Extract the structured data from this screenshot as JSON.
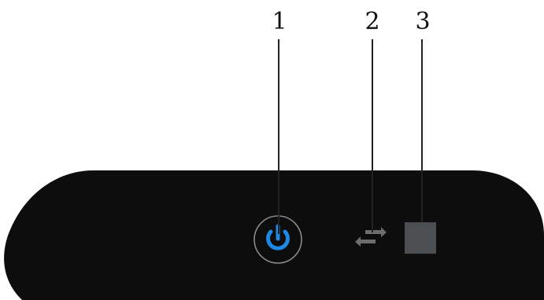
{
  "callouts": [
    {
      "number": "1",
      "target": "power-button"
    },
    {
      "number": "2",
      "target": "network-activity-indicator"
    },
    {
      "number": "3",
      "target": "square-indicator"
    }
  ],
  "colors": {
    "device_body": "#0d0d0d",
    "power_ring": "#8a8a8a",
    "power_icon": "#1e88e5",
    "square_indicator": "#4b4f52",
    "arrows": "#6d6d6d",
    "leader_lines": "#222222",
    "background": "#ffffff"
  },
  "icons": {
    "power": "power-icon",
    "network": "network-arrows-icon"
  }
}
